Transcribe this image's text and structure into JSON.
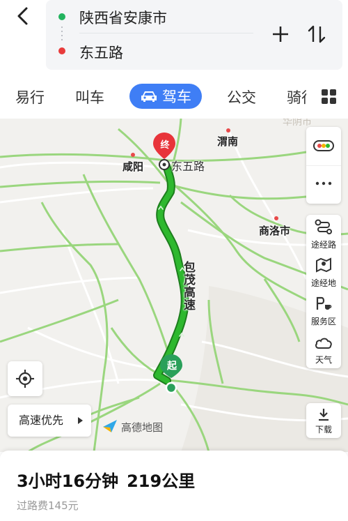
{
  "route": {
    "origin": "陕西省安康市",
    "destination": "东五路"
  },
  "tabs": [
    {
      "label": "易行"
    },
    {
      "label": "叫车"
    },
    {
      "label": "驾车",
      "active": true
    },
    {
      "label": "公交"
    },
    {
      "label": "骑行"
    }
  ],
  "map": {
    "cities": [
      {
        "name": "咸阳"
      },
      {
        "name": "渭南"
      },
      {
        "name": "商洛市"
      }
    ],
    "faded_city": "华阴市",
    "destination_marker": "终",
    "destination_label": "东五路",
    "start_marker": "起",
    "road_name": "包茂高速",
    "route_color": "#2eb82e"
  },
  "controls": {
    "traffic_icon": "traffic-light-icon",
    "more_icon": "more-icon",
    "waypoint_route": "途经路",
    "waypoint_place": "途经地",
    "service_area": "服务区",
    "weather": "天气",
    "download": "下载"
  },
  "preference": "高速优先",
  "logo_text": "高德地图",
  "summary": {
    "duration": "3小时16分钟",
    "distance": "219公里",
    "toll": "过路费145元"
  },
  "colors": {
    "accent": "#3f7ef5",
    "origin_dot": "#22b35e",
    "destination_dot": "#e83b3b"
  }
}
